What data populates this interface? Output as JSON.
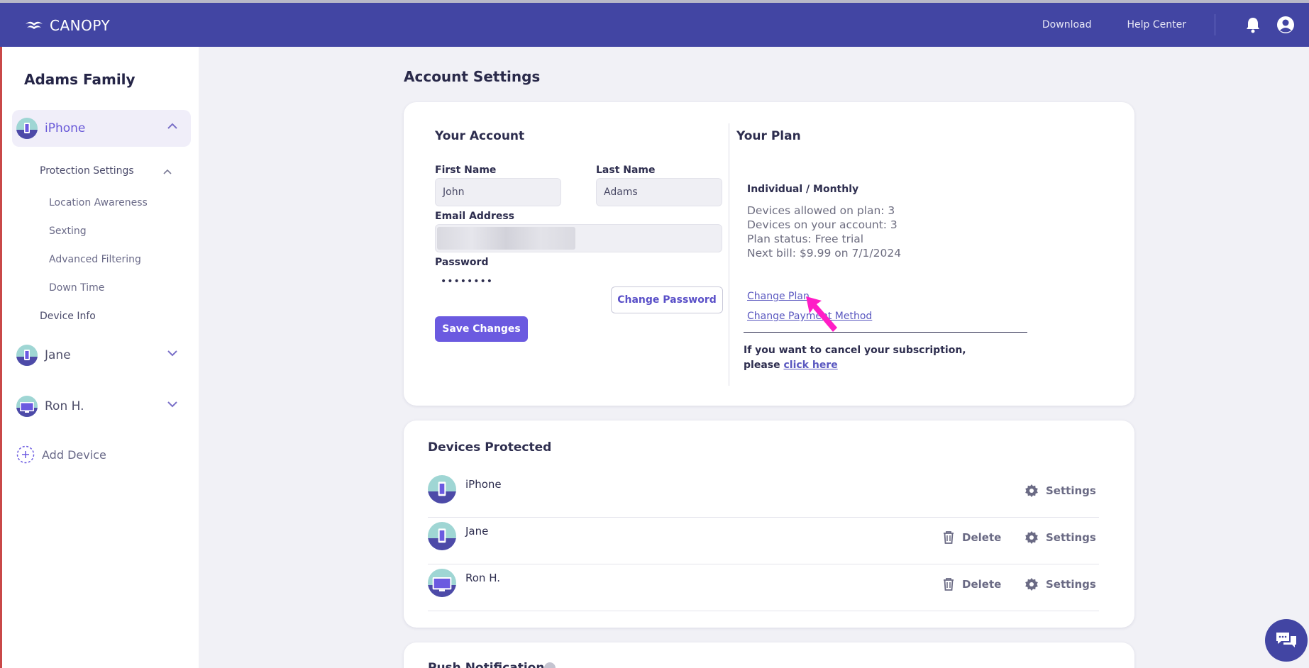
{
  "topbar": {
    "brand": "CANOPY",
    "links": [
      "Download",
      "Help Center"
    ],
    "icons": [
      "bell-icon",
      "account-icon"
    ]
  },
  "sidebar": {
    "family_name": "Adams Family",
    "devices": [
      {
        "name": "iPhone",
        "type": "phone",
        "expanded": true
      },
      {
        "name": "Jane",
        "type": "phone",
        "expanded": false
      },
      {
        "name": "Ron H.",
        "type": "desktop",
        "expanded": false
      }
    ],
    "protection_settings": "Protection Settings",
    "sub_items": [
      "Location Awareness",
      "Sexting",
      "Advanced Filtering",
      "Down Time"
    ],
    "device_info": "Device Info",
    "add_device": "Add Device"
  },
  "page": {
    "title": "Account Settings"
  },
  "account": {
    "section_title": "Your Account",
    "first_name_label": "First Name",
    "first_name_value": "John",
    "last_name_label": "Last Name",
    "last_name_value": "Adams",
    "email_label": "Email Address",
    "password_label": "Password",
    "password_value": "••••••••",
    "change_password": "Change Password",
    "save_changes": "Save Changes"
  },
  "plan": {
    "section_title": "Your Plan",
    "name": "Individual / Monthly",
    "lines": [
      "Devices allowed on plan: 3",
      "Devices on your account: 3",
      "Plan status: Free trial",
      "Next bill: $9.99 on 7/1/2024"
    ],
    "change_plan": "Change Plan",
    "change_payment": "Change Payment Method",
    "cancel_text_1": "If you want to cancel your subscription,",
    "cancel_text_2": "please ",
    "cancel_link": "click here"
  },
  "devices_protected": {
    "title": "Devices Protected",
    "rows": [
      {
        "name": "iPhone",
        "type": "phone",
        "can_delete": false
      },
      {
        "name": "Jane",
        "type": "phone",
        "can_delete": true
      },
      {
        "name": "Ron H.",
        "type": "desktop",
        "can_delete": true
      }
    ],
    "delete_label": "Delete",
    "settings_label": "Settings"
  },
  "push": {
    "title": "Push Notifications"
  },
  "colors": {
    "topbar": "#4245a3",
    "accent": "#6b5ae0",
    "cursor": "#ff1dc6"
  }
}
